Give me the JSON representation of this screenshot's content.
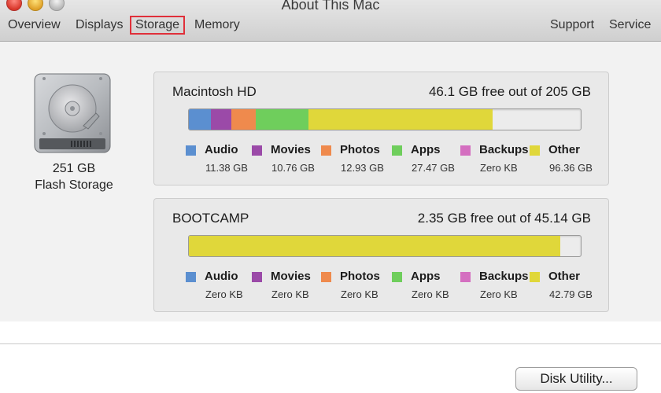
{
  "window": {
    "title": "About This Mac",
    "tabs": [
      "Overview",
      "Displays",
      "Storage",
      "Memory"
    ],
    "selected_tab": "Storage",
    "right_tabs": [
      "Support",
      "Service"
    ]
  },
  "drive": {
    "capacity": "251 GB",
    "type": "Flash Storage"
  },
  "legend_labels": [
    "Audio",
    "Movies",
    "Photos",
    "Apps",
    "Backups",
    "Other"
  ],
  "category_colors": {
    "audio": "#5b8fd0",
    "movies": "#9b4aa8",
    "photos": "#ef8a4d",
    "apps": "#6fce5c",
    "backups": "#d46fc0",
    "other": "#e0d73a"
  },
  "volumes": [
    {
      "name": "Macintosh HD",
      "free_text": "46.1 GB free out of 205 GB",
      "values": [
        "11.38 GB",
        "10.76 GB",
        "12.93 GB",
        "27.47 GB",
        "Zero KB",
        "96.36 GB"
      ],
      "bar_fractions": [
        0.056,
        0.052,
        0.063,
        0.134,
        0.0,
        0.47,
        0.225
      ]
    },
    {
      "name": "BOOTCAMP",
      "free_text": "2.35 GB free out of 45.14 GB",
      "values": [
        "Zero KB",
        "Zero KB",
        "Zero KB",
        "Zero KB",
        "Zero KB",
        "42.79 GB"
      ],
      "bar_fractions": [
        0,
        0,
        0,
        0,
        0,
        0.948,
        0.052
      ]
    }
  ],
  "disk_utility_button": "Disk Utility..."
}
